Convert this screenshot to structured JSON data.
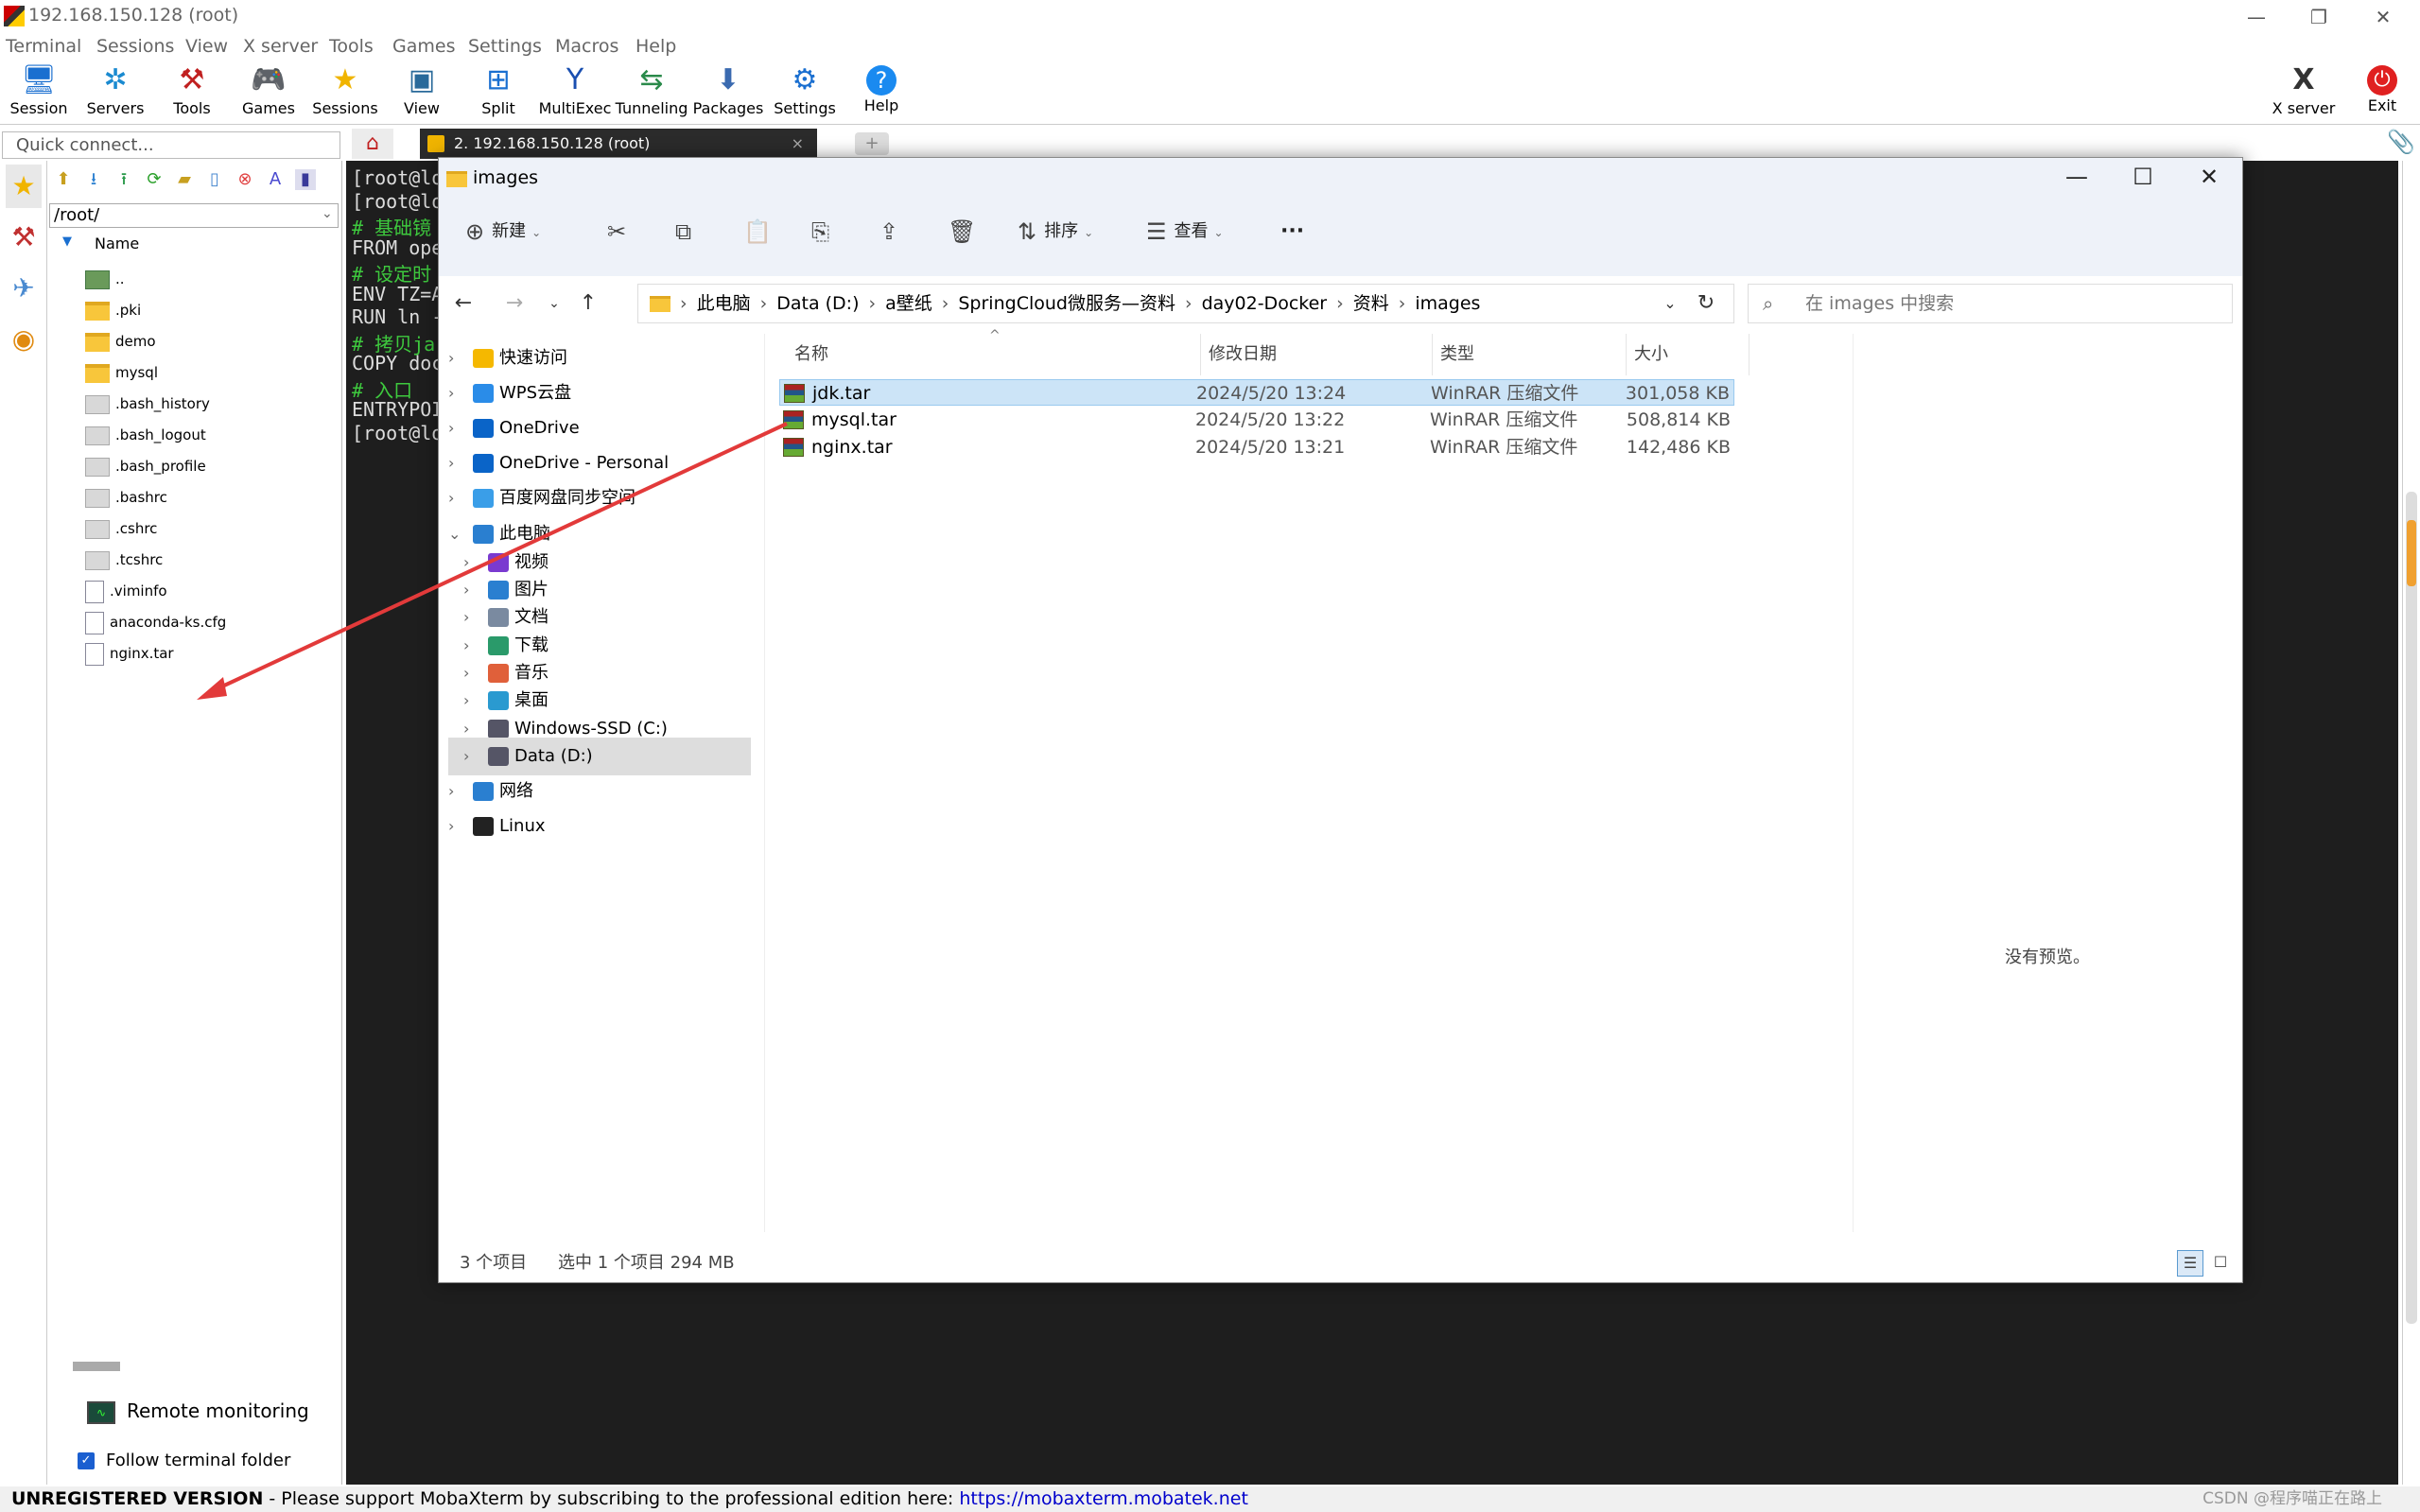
{
  "window": {
    "title": "192.168.150.128 (root)"
  },
  "menu": [
    "Terminal",
    "Sessions",
    "View",
    "X server",
    "Tools",
    "Games",
    "Settings",
    "Macros",
    "Help"
  ],
  "toolbar": [
    {
      "label": "Session",
      "icon": "session-icon"
    },
    {
      "label": "Servers",
      "icon": "servers-icon"
    },
    {
      "label": "Tools",
      "icon": "tools-icon"
    },
    {
      "label": "Games",
      "icon": "games-icon"
    },
    {
      "label": "Sessions",
      "icon": "star-icon"
    },
    {
      "label": "View",
      "icon": "view-icon"
    },
    {
      "label": "Split",
      "icon": "split-icon"
    },
    {
      "label": "MultiExec",
      "icon": "multiexec-icon"
    },
    {
      "label": "Tunneling",
      "icon": "tunneling-icon"
    },
    {
      "label": "Packages",
      "icon": "packages-icon"
    },
    {
      "label": "Settings",
      "icon": "gear-icon"
    },
    {
      "label": "Help",
      "icon": "help-icon"
    }
  ],
  "toolbar_right": {
    "xserver": "X server",
    "exit": "Exit"
  },
  "quick_connect": {
    "placeholder": "Quick connect..."
  },
  "file_panel": {
    "path": "/root/",
    "column": "Name",
    "items": [
      {
        "name": "..",
        "kind": "up"
      },
      {
        "name": ".pki",
        "kind": "folder"
      },
      {
        "name": "demo",
        "kind": "folder"
      },
      {
        "name": "mysql",
        "kind": "folder"
      },
      {
        "name": ".bash_history",
        "kind": "file"
      },
      {
        "name": ".bash_logout",
        "kind": "file"
      },
      {
        "name": ".bash_profile",
        "kind": "file"
      },
      {
        "name": ".bashrc",
        "kind": "file"
      },
      {
        "name": ".cshrc",
        "kind": "file"
      },
      {
        "name": ".tcshrc",
        "kind": "file"
      },
      {
        "name": ".viminfo",
        "kind": "doc"
      },
      {
        "name": "anaconda-ks.cfg",
        "kind": "doc"
      },
      {
        "name": "nginx.tar",
        "kind": "doc"
      }
    ],
    "remote_monitoring": "Remote monitoring",
    "follow_folder": "Follow terminal folder"
  },
  "tab": {
    "label": "2. 192.168.150.128 (root)"
  },
  "terminal_lines": [
    "[root@lo",
    "[root@lo",
    "# 基础镜",
    "FROM ope",
    "# 设定时",
    "ENV TZ=A",
    "RUN ln -",
    "# 拷贝ja",
    "COPY doc",
    "# 入口",
    "ENTRYPOI",
    "[root@lo"
  ],
  "status_bar": {
    "unregistered": "UNREGISTERED VERSION",
    "message": "  -  Please support MobaXterm by subscribing to the professional edition here:  ",
    "link": "https://mobaxterm.mobatek.net",
    "watermark": "CSDN @程序喵正在路上"
  },
  "explorer": {
    "title": "images",
    "commands": {
      "new": "新建",
      "sort": "排序",
      "view": "查看",
      "more": "···"
    },
    "breadcrumb": [
      "此电脑",
      "Data (D:)",
      "a壁纸",
      "SpringCloud微服务—资料",
      "day02-Docker",
      "资料",
      "images"
    ],
    "search_placeholder": "在 images 中搜索",
    "nav": [
      {
        "label": "快速访问",
        "icon": "star-icon",
        "color": "#f5b800",
        "indent": 0
      },
      {
        "label": "WPS云盘",
        "icon": "cloud-icon",
        "color": "#2a8ce8",
        "indent": 0
      },
      {
        "label": "OneDrive",
        "icon": "cloud-icon",
        "color": "#0a64c8",
        "indent": 0
      },
      {
        "label": "OneDrive - Personal",
        "icon": "cloud-icon",
        "color": "#0a64c8",
        "indent": 0
      },
      {
        "label": "百度网盘同步空间",
        "icon": "sync-icon",
        "color": "#3a9ee8",
        "indent": 0
      },
      {
        "label": "此电脑",
        "icon": "computer-icon",
        "color": "#2a7fd0",
        "indent": 0,
        "expanded": true
      },
      {
        "label": "视频",
        "icon": "video-icon",
        "color": "#7a3ad0",
        "indent": 1
      },
      {
        "label": "图片",
        "icon": "picture-icon",
        "color": "#2a7fd0",
        "indent": 1
      },
      {
        "label": "文档",
        "icon": "document-icon",
        "color": "#7a8aa0",
        "indent": 1
      },
      {
        "label": "下载",
        "icon": "download-icon",
        "color": "#2a9a6a",
        "indent": 1
      },
      {
        "label": "音乐",
        "icon": "music-icon",
        "color": "#e0603a",
        "indent": 1
      },
      {
        "label": "桌面",
        "icon": "desktop-icon",
        "color": "#2a9ad0",
        "indent": 1
      },
      {
        "label": "Windows-SSD (C:)",
        "icon": "drive-icon",
        "color": "#556",
        "indent": 1
      },
      {
        "label": "Data (D:)",
        "icon": "drive-icon",
        "color": "#556",
        "indent": 1,
        "selected": true
      },
      {
        "label": "网络",
        "icon": "network-icon",
        "color": "#2a7fd0",
        "indent": 0
      },
      {
        "label": "Linux",
        "icon": "linux-icon",
        "color": "#222",
        "indent": 0
      }
    ],
    "columns": {
      "name": "名称",
      "date": "修改日期",
      "type": "类型",
      "size": "大小"
    },
    "files": [
      {
        "name": "jdk.tar",
        "date": "2024/5/20 13:24",
        "type": "WinRAR 压缩文件",
        "size": "301,058 KB",
        "selected": true
      },
      {
        "name": "mysql.tar",
        "date": "2024/5/20 13:22",
        "type": "WinRAR 压缩文件",
        "size": "508,814 KB"
      },
      {
        "name": "nginx.tar",
        "date": "2024/5/20 13:21",
        "type": "WinRAR 压缩文件",
        "size": "142,486 KB"
      }
    ],
    "preview": "没有预览。",
    "status": {
      "count": "3 个项目",
      "selection": "选中 1 个项目  294 MB"
    }
  },
  "colors": {
    "annotation_arrow": "#e23a3a",
    "selection": "#cce4f7",
    "terminal_bg": "#1e1e1e"
  }
}
